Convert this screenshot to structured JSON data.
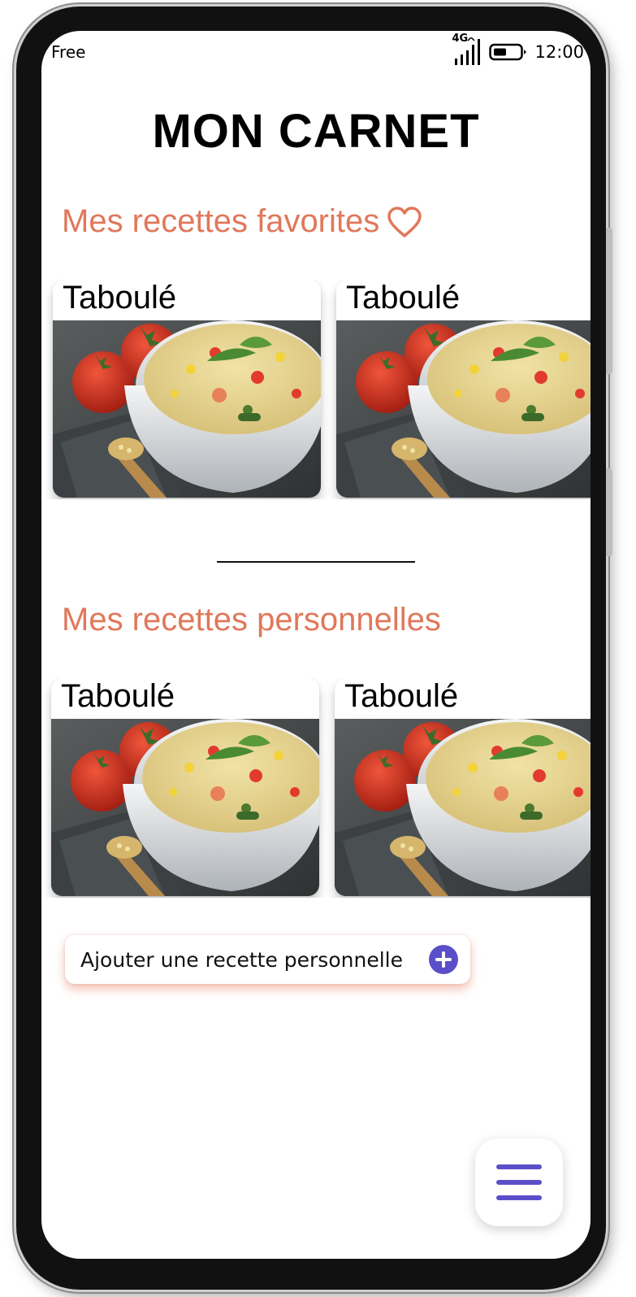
{
  "status_bar": {
    "carrier": "Free",
    "network": "4G",
    "time": "12:00"
  },
  "page": {
    "title": "MON CARNET"
  },
  "favorites": {
    "title": "Mes recettes favorites",
    "icon": "heart-icon",
    "cards": [
      {
        "title": "Taboulé"
      },
      {
        "title": "Taboulé"
      }
    ]
  },
  "personal": {
    "title": "Mes recettes personnelles",
    "cards": [
      {
        "title": "Taboulé"
      },
      {
        "title": "Taboulé"
      }
    ]
  },
  "add_button": {
    "label": "Ajouter une recette personnelle",
    "icon": "plus-circle-icon"
  },
  "menu_button": {
    "icon": "hamburger-menu-icon"
  },
  "colors": {
    "accent": "#e0785a",
    "primary": "#5b4fc9",
    "text": "#000000"
  }
}
